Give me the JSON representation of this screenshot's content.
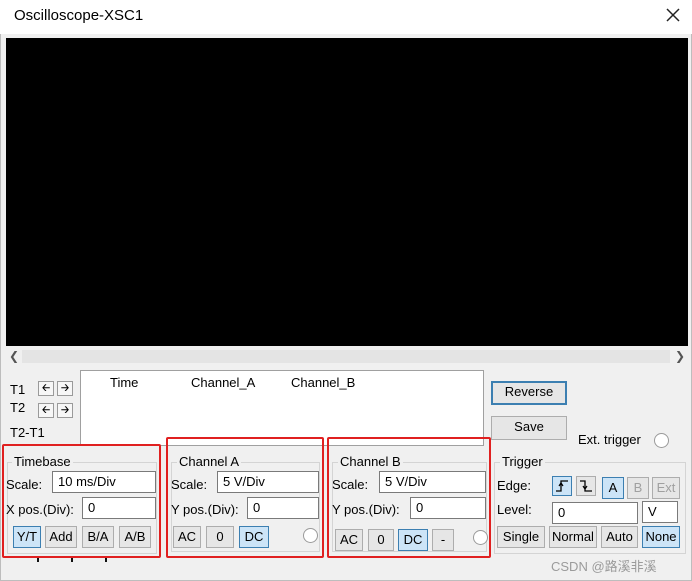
{
  "window": {
    "title": "Oscilloscope-XSC1",
    "close_icon": "close-icon"
  },
  "cursors": {
    "t1": "T1",
    "t2": "T2",
    "t2t1": "T2-T1"
  },
  "readout": {
    "columns": [
      "Time",
      "Channel_A",
      "Channel_B"
    ]
  },
  "side": {
    "reverse": "Reverse",
    "save": "Save",
    "ext_trigger": "Ext. trigger"
  },
  "timebase": {
    "title": "Timebase",
    "scale_label": "Scale:",
    "scale_value": "10 ms/Div",
    "xpos_label": "X pos.(Div):",
    "xpos_value": "0",
    "modes": [
      "Y/T",
      "Add",
      "B/A",
      "A/B"
    ],
    "selected_mode": "Y/T"
  },
  "channel_a": {
    "title": "Channel A",
    "scale_label": "Scale:",
    "scale_value": "5  V/Div",
    "ypos_label": "Y pos.(Div):",
    "ypos_value": "0",
    "coupling": [
      "AC",
      "0",
      "DC"
    ],
    "selected_coupling": "DC"
  },
  "channel_b": {
    "title": "Channel B",
    "scale_label": "Scale:",
    "scale_value": "5  V/Div",
    "ypos_label": "Y pos.(Div):",
    "ypos_value": "0",
    "coupling": [
      "AC",
      "0",
      "DC",
      "-"
    ],
    "selected_coupling": "DC"
  },
  "trigger": {
    "title": "Trigger",
    "edge_label": "Edge:",
    "edge_rise_icon": "rising-edge-icon",
    "edge_fall_icon": "falling-edge-icon",
    "sources": [
      "A",
      "B",
      "Ext"
    ],
    "selected_source": "A",
    "level_label": "Level:",
    "level_value": "0",
    "level_unit": "V",
    "modes": [
      "Single",
      "Normal",
      "Auto",
      "None"
    ],
    "selected_mode": "None"
  },
  "watermark": "CSDN @路溪非溪",
  "colors": {
    "screen": "#000000",
    "highlight": "#e02020",
    "selected": "#cce4f7"
  }
}
